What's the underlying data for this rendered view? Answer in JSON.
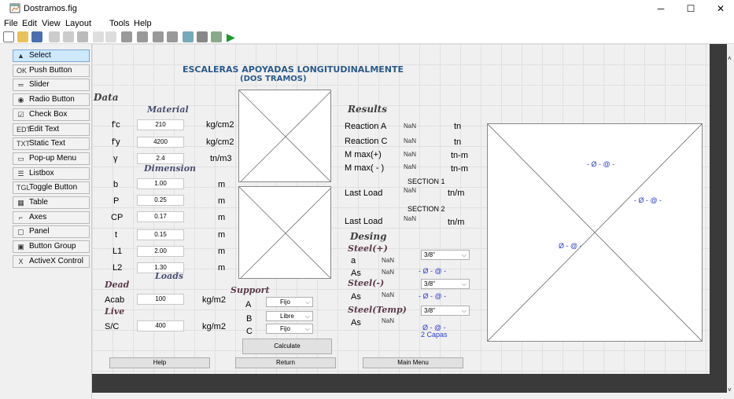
{
  "window": {
    "title": "Dostramos.fig",
    "minimize": "─",
    "maximize": "☐",
    "close": "✕"
  },
  "menu": [
    "File",
    "Edit",
    "View",
    "Layout",
    "Tools",
    "Help"
  ],
  "palette": [
    {
      "label": "Select",
      "icon": "▲"
    },
    {
      "label": "Push Button",
      "icon": "OK"
    },
    {
      "label": "Slider",
      "icon": "═"
    },
    {
      "label": "Radio Button",
      "icon": "◉"
    },
    {
      "label": "Check Box",
      "icon": "☑"
    },
    {
      "label": "Edit Text",
      "icon": "EDT"
    },
    {
      "label": "Static Text",
      "icon": "TXT"
    },
    {
      "label": "Pop-up Menu",
      "icon": "▭"
    },
    {
      "label": "Listbox",
      "icon": "☰"
    },
    {
      "label": "Toggle Button",
      "icon": "TGL"
    },
    {
      "label": "Table",
      "icon": "▦"
    },
    {
      "label": "Axes",
      "icon": "⌐"
    },
    {
      "label": "Panel",
      "icon": "▢"
    },
    {
      "label": "Button Group",
      "icon": "▣"
    },
    {
      "label": "ActiveX Control",
      "icon": "X"
    }
  ],
  "form": {
    "title1": "ESCALERAS APOYADAS LONGITUDINALMENTE",
    "title2": "(DOS TRAMOS)",
    "data": "Data",
    "material": "Material",
    "dimension": "Dimension",
    "loads": "Loads",
    "dead": "Dead",
    "live": "Live",
    "support": "Support",
    "results": "Results",
    "desing": "Desing",
    "steel_pos": "Steel(+)",
    "steel_neg": "Steel(-)",
    "steel_temp": "Steel(Temp)",
    "fc": {
      "label": "f'c",
      "value": "210",
      "unit": "kg/cm2"
    },
    "fy": {
      "label": "f'y",
      "value": "4200",
      "unit": "kg/cm2"
    },
    "gamma": {
      "label": "γ",
      "value": "2.4",
      "unit": "tn/m3"
    },
    "b": {
      "label": "b",
      "value": "1.00",
      "unit": "m"
    },
    "P": {
      "label": "P",
      "value": "0.25",
      "unit": "m"
    },
    "CP": {
      "label": "CP",
      "value": "0.17",
      "unit": "m"
    },
    "t": {
      "label": "t",
      "value": "0.15",
      "unit": "m"
    },
    "L1": {
      "label": "L1",
      "value": "2.00",
      "unit": "m"
    },
    "L2": {
      "label": "L2",
      "value": "1.30",
      "unit": "m"
    },
    "acab": {
      "label": "Acab",
      "value": "100",
      "unit": "kg/m2"
    },
    "sc": {
      "label": "S/C",
      "value": "400",
      "unit": "kg/m2"
    },
    "supA": {
      "label": "A",
      "value": "Fijo"
    },
    "supB": {
      "label": "B",
      "value": "Libre"
    },
    "supC": {
      "label": "C",
      "value": "Fijo"
    },
    "reactA": {
      "label": "Reaction A",
      "value": "NaN",
      "unit": "tn"
    },
    "reactC": {
      "label": "Reaction C",
      "value": "NaN",
      "unit": "tn"
    },
    "mpos": {
      "label": "M max(+)",
      "value": "NaN",
      "unit": "tn-m"
    },
    "mneg": {
      "label": "M max( - )",
      "value": "NaN",
      "unit": "tn-m"
    },
    "section1": "SECTION 1",
    "last1": {
      "label": "Last Load",
      "value": "NaN",
      "unit": "tn/m"
    },
    "section2": "SECTION 2",
    "last2": {
      "label": "Last Load",
      "value": "NaN",
      "unit": "tn/m"
    },
    "a": {
      "label": "a",
      "value": "NaN"
    },
    "as1": {
      "label": "As",
      "value": "NaN"
    },
    "as2": {
      "label": "As",
      "value": "NaN"
    },
    "as3": {
      "label": "As",
      "value": "NaN"
    },
    "pop1": "3/8\"",
    "pop2": "3/8\"",
    "pop3": "3/8\"",
    "phi1": "-  Ø  -   @   -",
    "phi2": "-  Ø  -   @   -",
    "phi3": "Ø  -   @   -",
    "capas": "2 Capas",
    "calc": "Calculate",
    "help": "Help",
    "return": "Return",
    "main": "Main Menu",
    "axL1": "-  Ø  -   @   -",
    "axL2": "-  Ø  -   @   -",
    "axL3": "Ø  -   @   -"
  }
}
